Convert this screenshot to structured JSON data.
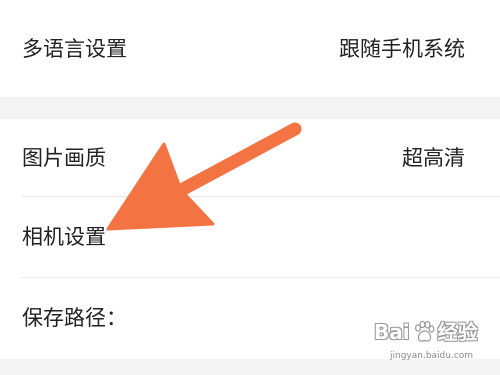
{
  "settings": {
    "section1": {
      "rows": [
        {
          "label": "多语言设置",
          "value": "跟随手机系统"
        }
      ]
    },
    "section2": {
      "rows": [
        {
          "label": "图片画质",
          "value": "超高清"
        },
        {
          "label": "相机设置"
        },
        {
          "label": "保存路径："
        }
      ]
    }
  },
  "annotation": {
    "arrow_color": "#F47342"
  },
  "colors": {
    "background": "#F4F4F4",
    "card": "#FFFFFF",
    "text": "#222222",
    "divider": "#E8E8E8"
  },
  "watermark": {
    "brand_prefix": "Bai",
    "brand_suffix": "经验",
    "url": "jingyan.baidu.com",
    "icon": "paw-icon"
  }
}
